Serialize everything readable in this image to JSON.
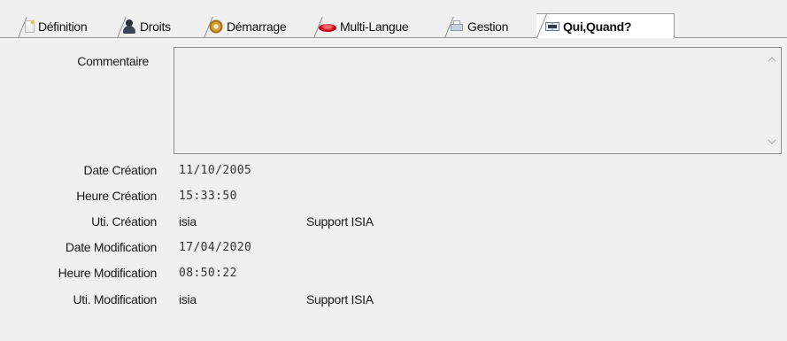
{
  "tabs": [
    {
      "label": "Définition",
      "icon": "document-icon",
      "active": false
    },
    {
      "label": "Droits",
      "icon": "user-icon",
      "active": false
    },
    {
      "label": "Démarrage",
      "icon": "gear-icon",
      "active": false
    },
    {
      "label": "Multi-Langue",
      "icon": "lips-icon",
      "active": false
    },
    {
      "label": "Gestion",
      "icon": "printer-icon",
      "active": false
    },
    {
      "label": "Qui,Quand?",
      "icon": "book-icon",
      "active": true
    }
  ],
  "form": {
    "comment_label": "Commentaire",
    "comment_value": "",
    "rows": [
      {
        "label": "Date Création",
        "value": "11/10/2005",
        "mono": true,
        "extra": ""
      },
      {
        "label": "Heure Création",
        "value": "15:33:50",
        "mono": true,
        "extra": ""
      },
      {
        "label": "Uti. Création",
        "value": "isia",
        "mono": false,
        "extra": "Support ISIA"
      },
      {
        "label": "Date Modification",
        "value": "17/04/2020",
        "mono": true,
        "extra": ""
      },
      {
        "label": "Heure Modification",
        "value": "08:50:22",
        "mono": true,
        "extra": ""
      },
      {
        "label": "Uti. Modification",
        "value": "isia",
        "mono": false,
        "extra": "Support ISIA"
      }
    ]
  },
  "colors": {
    "background": "#f0f0f0",
    "active_tab": "#ffffff",
    "border": "#8c8c8c"
  }
}
